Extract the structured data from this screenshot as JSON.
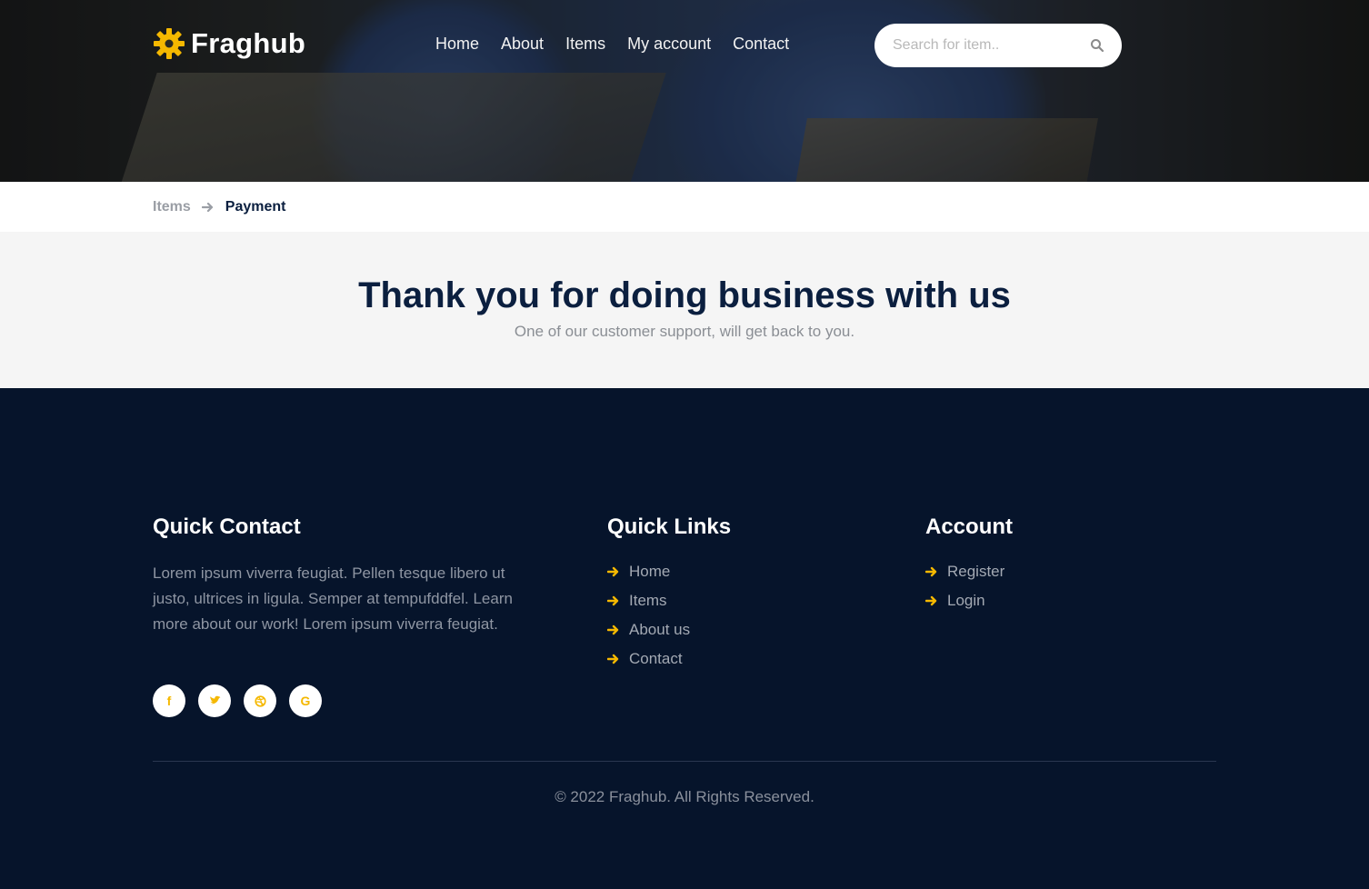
{
  "brand": {
    "name": "Fraghub",
    "accent_color": "#f5b800",
    "logo_icon": "gear-icon"
  },
  "nav": {
    "items": [
      "Home",
      "About",
      "Items",
      "My account",
      "Contact"
    ]
  },
  "search": {
    "placeholder": "Search for item..",
    "icon": "search-icon"
  },
  "breadcrumb": {
    "items": [
      "Items",
      "Payment"
    ],
    "separator_icon": "arrow-right-icon"
  },
  "thanks": {
    "title": "Thank you for doing business with us",
    "subtitle": "One of our customer support, will get back to you."
  },
  "footer": {
    "quick_contact": {
      "title": "Quick Contact",
      "text": "Lorem ipsum viverra feugiat. Pellen tesque libero ut justo, ultrices in ligula. Semper at tempufddfel. Learn more about our work! Lorem ipsum viverra feugiat.",
      "social": [
        "facebook-icon",
        "twitter-icon",
        "dribbble-icon",
        "google-icon"
      ]
    },
    "quick_links": {
      "title": "Quick Links",
      "items": [
        "Home",
        "Items",
        "About us",
        "Contact"
      ]
    },
    "account": {
      "title": "Account",
      "items": [
        "Register",
        "Login"
      ]
    },
    "copyright": "© 2022 Fraghub. All Rights Reserved."
  }
}
